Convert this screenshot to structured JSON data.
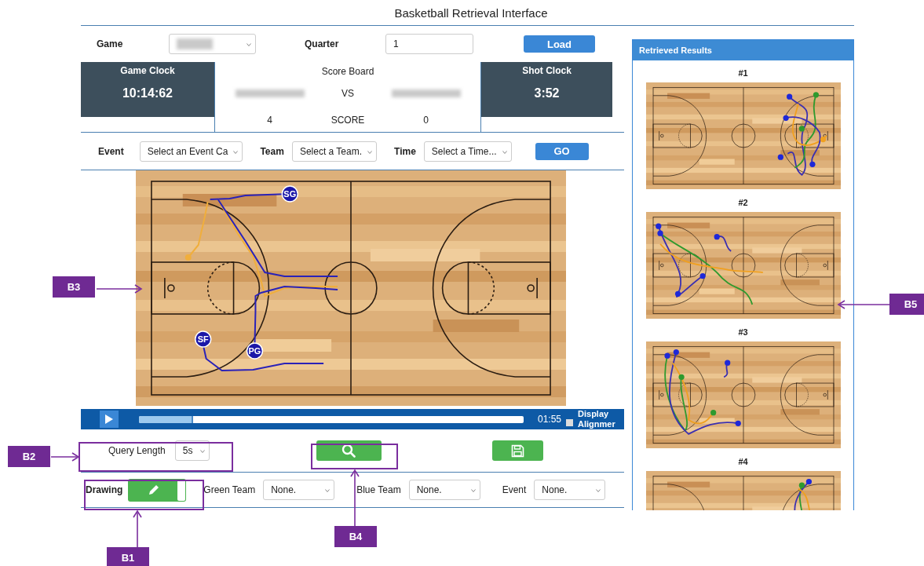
{
  "title": "Basketball Retrieval Interface",
  "game": {
    "label": "Game"
  },
  "quarter": {
    "label": "Quarter",
    "value": "1"
  },
  "load_button": "Load",
  "scoreboard": {
    "game_clock": {
      "label": "Game Clock",
      "value": "10:14:62"
    },
    "title": "Score Board",
    "vs": "VS",
    "score_label": "SCORE",
    "home_score": "4",
    "away_score": "0",
    "shot_clock": {
      "label": "Shot Clock",
      "value": "3:52"
    }
  },
  "filters": [
    {
      "label": "Event",
      "value": "Select an Event Ca"
    },
    {
      "label": "Team",
      "value": "Select a Team."
    },
    {
      "label": "Time",
      "value": "Select a Time..."
    }
  ],
  "go_button": "GO",
  "court": {
    "players": [
      {
        "label": "SG"
      },
      {
        "label": "SF"
      },
      {
        "label": "PG"
      }
    ]
  },
  "player": {
    "level": 0.14,
    "time": "01:55",
    "display_alignment": {
      "label": "Display Alignmer",
      "checked": false
    }
  },
  "query": {
    "label": "Query Length",
    "value": "5s"
  },
  "drawing": {
    "label": "Drawing",
    "on": true
  },
  "team_filters": [
    {
      "label": "Green Team",
      "value": "None."
    },
    {
      "label": "Blue Team",
      "value": "None."
    },
    {
      "label": "Event",
      "value": "None."
    }
  ],
  "results": {
    "title": "Retrieved Results",
    "items": [
      {
        "label": "#1"
      },
      {
        "label": "#2"
      },
      {
        "label": "#3"
      },
      {
        "label": "#4"
      }
    ]
  },
  "annotations": [
    {
      "label": "B3"
    },
    {
      "label": "B2"
    },
    {
      "label": "B1"
    },
    {
      "label": "B4"
    },
    {
      "label": "B5"
    }
  ]
}
